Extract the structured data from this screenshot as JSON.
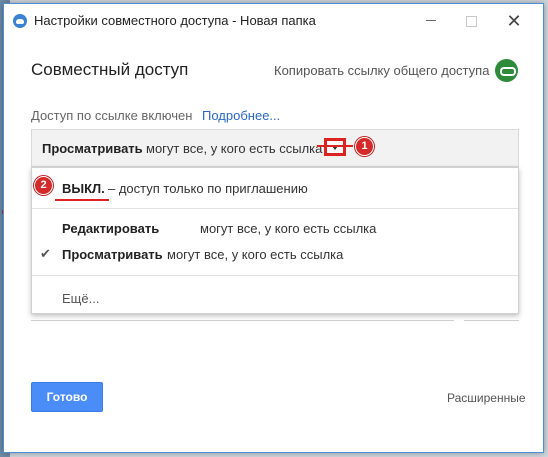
{
  "window": {
    "title": "Настройки совместного доступа - Новая папка"
  },
  "header": {
    "heading": "Совместный доступ",
    "copy_link_label": "Копировать ссылку общего доступа"
  },
  "link_status": {
    "text": "Доступ по ссылке включен",
    "more_link": "Подробнее..."
  },
  "access_select": {
    "selected_bold": "Просматривать",
    "selected_rest": "могут все, у кого есть ссылка"
  },
  "annotations": {
    "badge_1": "1",
    "badge_2": "2"
  },
  "menu": {
    "items": [
      {
        "bold": "ВЫКЛ.",
        "rest": "– доступ только по приглашению"
      },
      {
        "bold": "Редактировать",
        "rest": "могут все, у кого есть ссылка"
      },
      {
        "bold": "Просматривать",
        "rest": "могут все, у кого есть ссылка",
        "check": "✔"
      },
      {
        "bold": "",
        "rest": "Ещё..."
      }
    ]
  },
  "footer": {
    "done_label": "Готово",
    "advanced_label": "Расширенные"
  },
  "colors": {
    "accent": "#4a8df8",
    "link": "#2867c8",
    "annotation": "#d22222",
    "copy_icon": "#2e8b3a"
  },
  "icons": {
    "app": "google-drive-icon",
    "copy": "link-icon",
    "dropdown": "chevron-down-icon",
    "check": "check-icon"
  }
}
